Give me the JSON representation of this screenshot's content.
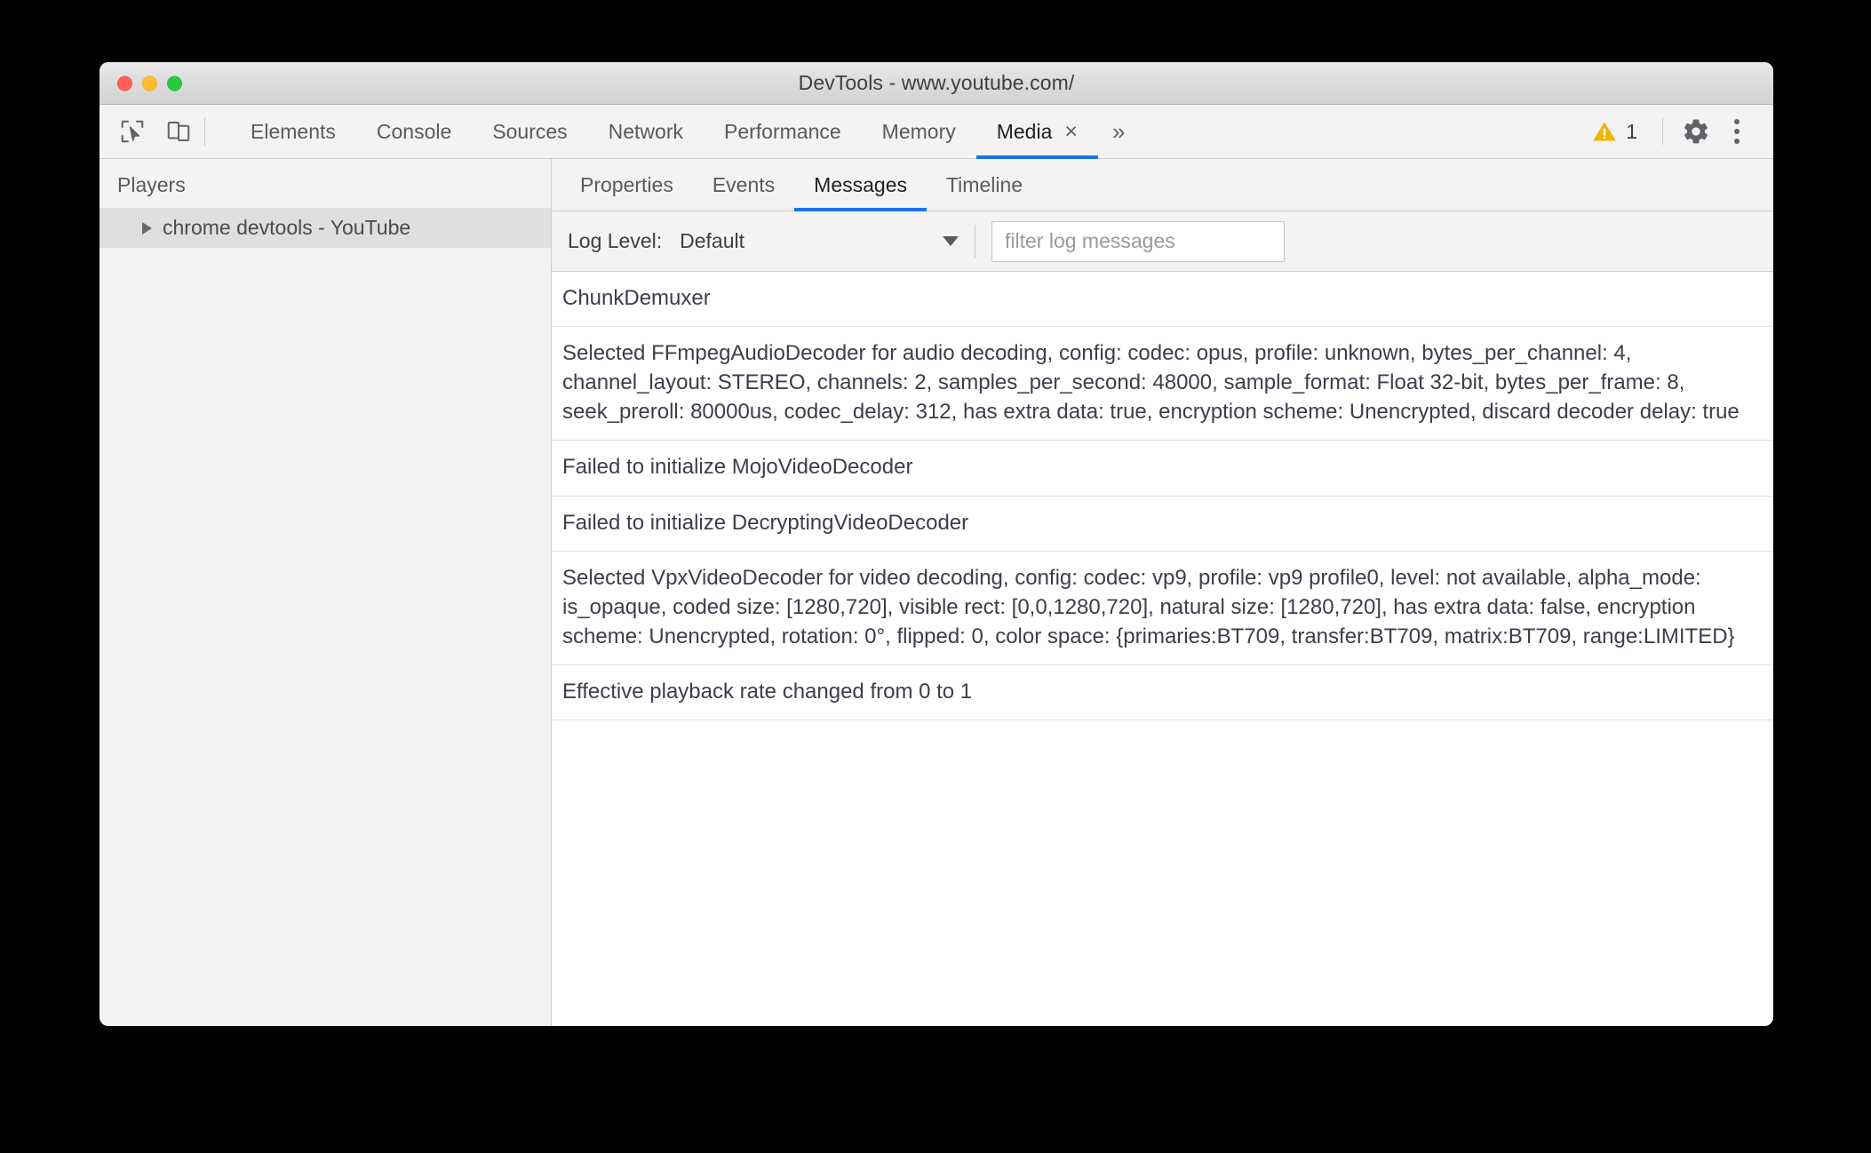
{
  "window": {
    "title": "DevTools - www.youtube.com/",
    "traffic_lights": [
      "close",
      "minimize",
      "maximize"
    ]
  },
  "toolbar": {
    "inspect_icon": "inspect-cursor-icon",
    "device_icon": "device-toolbar-icon",
    "tabs": [
      {
        "label": "Elements",
        "active": false
      },
      {
        "label": "Console",
        "active": false
      },
      {
        "label": "Sources",
        "active": false
      },
      {
        "label": "Network",
        "active": false
      },
      {
        "label": "Performance",
        "active": false
      },
      {
        "label": "Memory",
        "active": false
      },
      {
        "label": "Media",
        "active": true
      }
    ],
    "media_tab_close": "×",
    "overflow_label": "»",
    "warning_count": "1",
    "warning_color": "#f4b400",
    "gear_icon": "gear-icon",
    "menu_icon": "kebab-menu-icon",
    "accent_color": "#1a73e8"
  },
  "sidebar": {
    "header": "Players",
    "items": [
      {
        "label": "chrome devtools - YouTube",
        "selected": true
      }
    ]
  },
  "subtabs": [
    {
      "label": "Properties",
      "active": false
    },
    {
      "label": "Events",
      "active": false
    },
    {
      "label": "Messages",
      "active": true
    },
    {
      "label": "Timeline",
      "active": false
    }
  ],
  "filter_bar": {
    "log_level_label": "Log Level:",
    "log_level_value": "Default",
    "filter_placeholder": "filter log messages",
    "filter_value": ""
  },
  "messages": [
    {
      "text": "ChunkDemuxer"
    },
    {
      "text": "Selected FFmpegAudioDecoder for audio decoding, config: codec: opus, profile: unknown, bytes_per_channel: 4, channel_layout: STEREO, channels: 2, samples_per_second: 48000, sample_format: Float 32-bit, bytes_per_frame: 8, seek_preroll: 80000us, codec_delay: 312, has extra data: true, encryption scheme: Unencrypted, discard decoder delay: true"
    },
    {
      "text": "Failed to initialize MojoVideoDecoder"
    },
    {
      "text": "Failed to initialize DecryptingVideoDecoder"
    },
    {
      "text": "Selected VpxVideoDecoder for video decoding, config: codec: vp9, profile: vp9 profile0, level: not available, alpha_mode: is_opaque, coded size: [1280,720], visible rect: [0,0,1280,720], natural size: [1280,720], has extra data: false, encryption scheme: Unencrypted, rotation: 0°, flipped: 0, color space: {primaries:BT709, transfer:BT709, matrix:BT709, range:LIMITED}"
    },
    {
      "text": "Effective playback rate changed from 0 to 1"
    }
  ]
}
